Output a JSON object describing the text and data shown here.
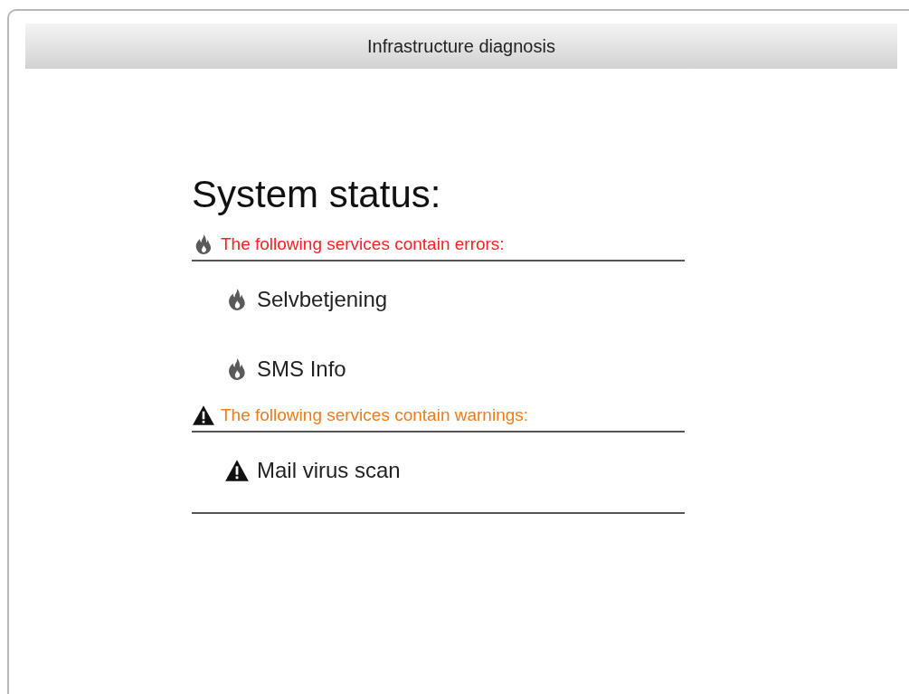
{
  "window": {
    "title": "Infrastructure diagnosis"
  },
  "heading": "System status:",
  "sections": [
    {
      "kind": "error",
      "label": "The following services contain errors:",
      "items": [
        "Selvbetjening",
        "SMS Info"
      ]
    },
    {
      "kind": "warning",
      "label": "The following services contain warnings:",
      "items": [
        "Mail virus scan"
      ]
    }
  ]
}
